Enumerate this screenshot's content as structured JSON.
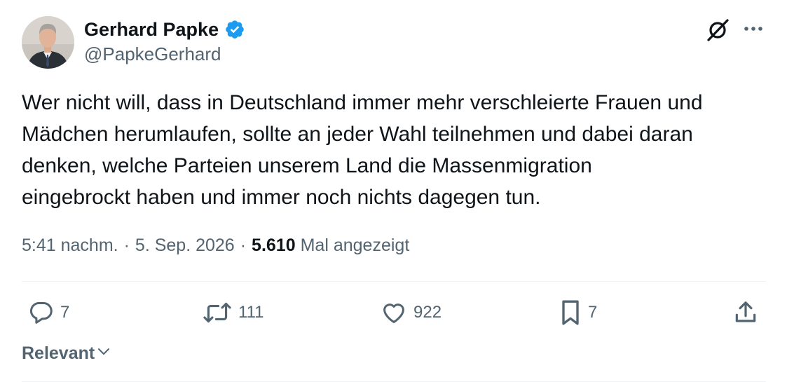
{
  "author": {
    "name": "Gerhard Papke",
    "handle": "@PapkeGerhard",
    "verified": true,
    "verified_color": "#1d9bf0"
  },
  "header_icons": [
    "grok-icon",
    "more-icon"
  ],
  "tweet": {
    "text": "Wer nicht will, dass in Deutschland immer mehr verschleierte Frauen und\nMädchen herumlaufen, sollte an jeder Wahl teilnehmen und dabei daran\ndenken, welche Parteien unserem Land die Massenmigration\neingebrockt haben und immer noch nichts dagegen tun."
  },
  "meta": {
    "time": "5:41 nachm.",
    "separator": "·",
    "date": "5. Sep. 2026",
    "views_count": "5.610",
    "views_label": "Mal angezeigt"
  },
  "actions": {
    "reply": {
      "icon": "reply-icon",
      "count": "7"
    },
    "retweet": {
      "icon": "retweet-icon",
      "count": "111"
    },
    "like": {
      "icon": "heart-icon",
      "count": "922"
    },
    "bookmark": {
      "icon": "bookmark-icon",
      "count": "7"
    },
    "share": {
      "icon": "share-icon"
    }
  },
  "sort": {
    "label": "Relevant",
    "icon": "chevron-down-icon"
  },
  "colors": {
    "text_primary": "#0f1419",
    "text_secondary": "#536471",
    "divider": "#eff3f4",
    "accent": "#1d9bf0"
  }
}
